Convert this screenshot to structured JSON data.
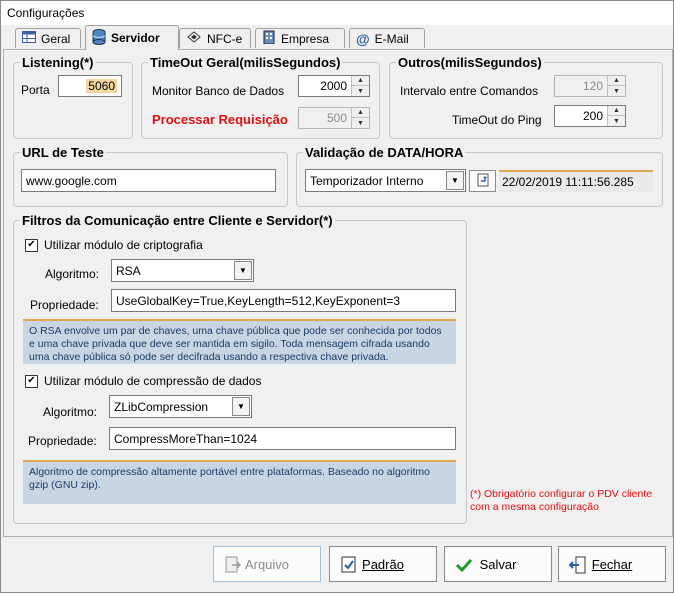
{
  "window": {
    "title": "Configurações"
  },
  "tabs": [
    {
      "label": "Geral",
      "icon": "table-icon"
    },
    {
      "label": "Servidor",
      "icon": "database-icon",
      "active": true
    },
    {
      "label": "NFC-e",
      "icon": "nfc-icon"
    },
    {
      "label": "Empresa",
      "icon": "building-icon"
    },
    {
      "label": "E-Mail",
      "icon": "at-icon"
    }
  ],
  "listening": {
    "title": "Listening(*)",
    "port_label": "Porta",
    "port_value": "5060"
  },
  "timeout": {
    "title": "TimeOut Geral(milisSegundos)",
    "monitor_label": "Monitor Banco de Dados",
    "monitor_value": "2000",
    "processar_label": "Processar Requisição",
    "processar_value": "500"
  },
  "outros": {
    "title": "Outros(milisSegundos)",
    "intervalo_label": "Intervalo entre Comandos",
    "intervalo_value": "120",
    "ping_label": "TimeOut do Ping",
    "ping_value": "200"
  },
  "url_teste": {
    "title": "URL de Teste",
    "value": "www.google.com"
  },
  "validacao": {
    "title": "Validação de DATA/HORA",
    "selected": "Temporizador Interno",
    "datetime": "22/02/2019 11:11:56.285"
  },
  "filtros": {
    "title": "Filtros da Comunicação entre Cliente e Servidor(*)",
    "cripto": {
      "check_label": "Utilizar módulo de criptografia",
      "checked": true,
      "algoritmo_label": "Algoritmo:",
      "algoritmo_value": "RSA",
      "propriedade_label": "Propriedade:",
      "propriedade_value": "UseGlobalKey=True,KeyLength=512,KeyExponent=3",
      "note": "O RSA envolve um par de chaves, uma chave pública que pode ser conhecida por todos e uma chave privada que deve ser mantida em sigilo. Toda mensagem cifrada usando uma chave pública só pode ser decifrada usando a respectiva chave privada."
    },
    "compress": {
      "check_label": "Utilizar módulo de compressão de dados",
      "checked": true,
      "algoritmo_label": "Algoritmo:",
      "algoritmo_value": "ZLibCompression",
      "propriedade_label": "Propriedade:",
      "propriedade_value": "CompressMoreThan=1024",
      "note": "Algoritmo de compressão altamente portável entre plataformas. Baseado no algoritmo gzip (GNU zip)."
    }
  },
  "warning": "(*) Obrigatório configurar o PDV cliente com a mesma configuração",
  "buttons": {
    "arquivo": "Arquivo",
    "padrao": "Padrão",
    "salvar": "Salvar",
    "fechar": "Fechar"
  },
  "colors": {
    "warning_red": "#e01010",
    "note_bg": "#c9d5e2",
    "selection_bg": "#f4d6a0"
  }
}
